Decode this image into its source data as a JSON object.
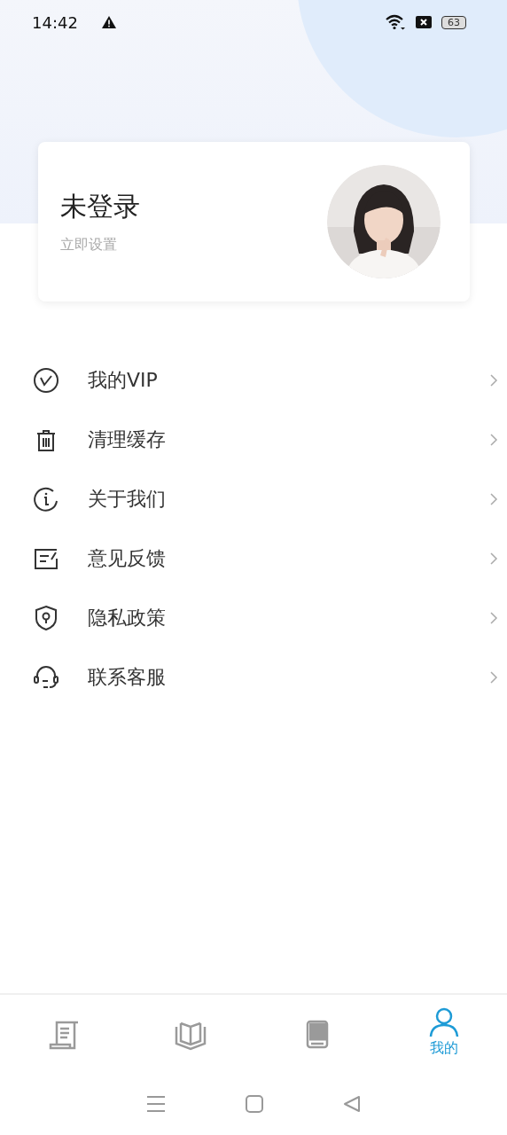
{
  "status_bar": {
    "time": "14:42",
    "battery": "63"
  },
  "profile": {
    "name": "未登录",
    "subtitle": "立即设置"
  },
  "menu": [
    {
      "kind": "vip",
      "label": "我的VIP"
    },
    {
      "kind": "trash",
      "label": "清理缓存"
    },
    {
      "kind": "info",
      "label": "关于我们"
    },
    {
      "kind": "feedback",
      "label": "意见反馈"
    },
    {
      "kind": "privacy",
      "label": "隐私政策"
    },
    {
      "kind": "support",
      "label": "联系客服"
    }
  ],
  "tabs": [
    {
      "kind": "scroll",
      "selected": false
    },
    {
      "kind": "open-book",
      "selected": false
    },
    {
      "kind": "book",
      "selected": false
    },
    {
      "kind": "user",
      "label": "我的",
      "selected": true
    }
  ]
}
